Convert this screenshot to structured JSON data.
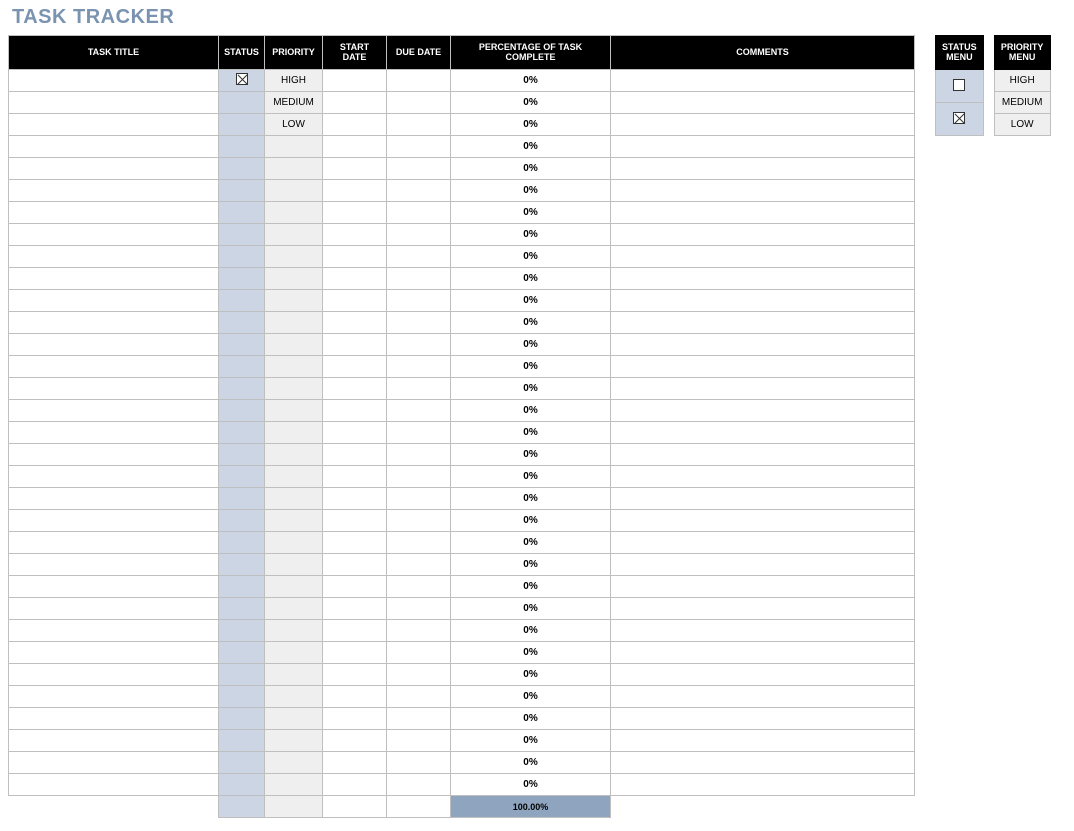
{
  "title": "TASK TRACKER",
  "columns": {
    "task_title": "TASK TITLE",
    "status": "STATUS",
    "priority": "PRIORITY",
    "start_date": "START DATE",
    "due_date": "DUE DATE",
    "pct_complete": "PERCENTAGE OF TASK COMPLETE",
    "comments": "COMMENTS"
  },
  "rows": [
    {
      "task_title": "",
      "status_checked": true,
      "priority": "HIGH",
      "start_date": "",
      "due_date": "",
      "pct": "0%",
      "comments": ""
    },
    {
      "task_title": "",
      "status_checked": false,
      "priority": "MEDIUM",
      "start_date": "",
      "due_date": "",
      "pct": "0%",
      "comments": ""
    },
    {
      "task_title": "",
      "status_checked": false,
      "priority": "LOW",
      "start_date": "",
      "due_date": "",
      "pct": "0%",
      "comments": ""
    },
    {
      "task_title": "",
      "status_checked": false,
      "priority": "",
      "start_date": "",
      "due_date": "",
      "pct": "0%",
      "comments": ""
    },
    {
      "task_title": "",
      "status_checked": false,
      "priority": "",
      "start_date": "",
      "due_date": "",
      "pct": "0%",
      "comments": ""
    },
    {
      "task_title": "",
      "status_checked": false,
      "priority": "",
      "start_date": "",
      "due_date": "",
      "pct": "0%",
      "comments": ""
    },
    {
      "task_title": "",
      "status_checked": false,
      "priority": "",
      "start_date": "",
      "due_date": "",
      "pct": "0%",
      "comments": ""
    },
    {
      "task_title": "",
      "status_checked": false,
      "priority": "",
      "start_date": "",
      "due_date": "",
      "pct": "0%",
      "comments": ""
    },
    {
      "task_title": "",
      "status_checked": false,
      "priority": "",
      "start_date": "",
      "due_date": "",
      "pct": "0%",
      "comments": ""
    },
    {
      "task_title": "",
      "status_checked": false,
      "priority": "",
      "start_date": "",
      "due_date": "",
      "pct": "0%",
      "comments": ""
    },
    {
      "task_title": "",
      "status_checked": false,
      "priority": "",
      "start_date": "",
      "due_date": "",
      "pct": "0%",
      "comments": ""
    },
    {
      "task_title": "",
      "status_checked": false,
      "priority": "",
      "start_date": "",
      "due_date": "",
      "pct": "0%",
      "comments": ""
    },
    {
      "task_title": "",
      "status_checked": false,
      "priority": "",
      "start_date": "",
      "due_date": "",
      "pct": "0%",
      "comments": ""
    },
    {
      "task_title": "",
      "status_checked": false,
      "priority": "",
      "start_date": "",
      "due_date": "",
      "pct": "0%",
      "comments": ""
    },
    {
      "task_title": "",
      "status_checked": false,
      "priority": "",
      "start_date": "",
      "due_date": "",
      "pct": "0%",
      "comments": ""
    },
    {
      "task_title": "",
      "status_checked": false,
      "priority": "",
      "start_date": "",
      "due_date": "",
      "pct": "0%",
      "comments": ""
    },
    {
      "task_title": "",
      "status_checked": false,
      "priority": "",
      "start_date": "",
      "due_date": "",
      "pct": "0%",
      "comments": ""
    },
    {
      "task_title": "",
      "status_checked": false,
      "priority": "",
      "start_date": "",
      "due_date": "",
      "pct": "0%",
      "comments": ""
    },
    {
      "task_title": "",
      "status_checked": false,
      "priority": "",
      "start_date": "",
      "due_date": "",
      "pct": "0%",
      "comments": ""
    },
    {
      "task_title": "",
      "status_checked": false,
      "priority": "",
      "start_date": "",
      "due_date": "",
      "pct": "0%",
      "comments": ""
    },
    {
      "task_title": "",
      "status_checked": false,
      "priority": "",
      "start_date": "",
      "due_date": "",
      "pct": "0%",
      "comments": ""
    },
    {
      "task_title": "",
      "status_checked": false,
      "priority": "",
      "start_date": "",
      "due_date": "",
      "pct": "0%",
      "comments": ""
    },
    {
      "task_title": "",
      "status_checked": false,
      "priority": "",
      "start_date": "",
      "due_date": "",
      "pct": "0%",
      "comments": ""
    },
    {
      "task_title": "",
      "status_checked": false,
      "priority": "",
      "start_date": "",
      "due_date": "",
      "pct": "0%",
      "comments": ""
    },
    {
      "task_title": "",
      "status_checked": false,
      "priority": "",
      "start_date": "",
      "due_date": "",
      "pct": "0%",
      "comments": ""
    },
    {
      "task_title": "",
      "status_checked": false,
      "priority": "",
      "start_date": "",
      "due_date": "",
      "pct": "0%",
      "comments": ""
    },
    {
      "task_title": "",
      "status_checked": false,
      "priority": "",
      "start_date": "",
      "due_date": "",
      "pct": "0%",
      "comments": ""
    },
    {
      "task_title": "",
      "status_checked": false,
      "priority": "",
      "start_date": "",
      "due_date": "",
      "pct": "0%",
      "comments": ""
    },
    {
      "task_title": "",
      "status_checked": false,
      "priority": "",
      "start_date": "",
      "due_date": "",
      "pct": "0%",
      "comments": ""
    },
    {
      "task_title": "",
      "status_checked": false,
      "priority": "",
      "start_date": "",
      "due_date": "",
      "pct": "0%",
      "comments": ""
    },
    {
      "task_title": "",
      "status_checked": false,
      "priority": "",
      "start_date": "",
      "due_date": "",
      "pct": "0%",
      "comments": ""
    },
    {
      "task_title": "",
      "status_checked": false,
      "priority": "",
      "start_date": "",
      "due_date": "",
      "pct": "0%",
      "comments": ""
    },
    {
      "task_title": "",
      "status_checked": false,
      "priority": "",
      "start_date": "",
      "due_date": "",
      "pct": "0%",
      "comments": ""
    }
  ],
  "total_pct": "100.00%",
  "status_menu": {
    "header": "STATUS MENU",
    "items": [
      {
        "checked": false
      },
      {
        "checked": true
      }
    ]
  },
  "priority_menu": {
    "header": "PRIORITY MENU",
    "items": [
      "HIGH",
      "MEDIUM",
      "LOW"
    ]
  }
}
